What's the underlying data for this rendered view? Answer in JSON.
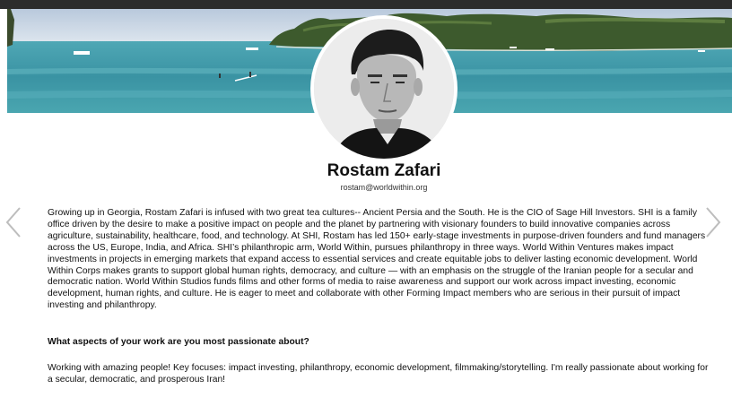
{
  "profile": {
    "name": "Rostam Zafari",
    "email": "rostam@worldwithin.org",
    "bio": "Growing up in Georgia, Rostam Zafari is infused with two great tea cultures-- Ancient Persia and the South. He is the CIO of Sage Hill Investors. SHI is a family office driven by the desire to make a positive impact on people and the planet by partnering with visionary founders to build innovative companies across agriculture, sustainability, healthcare, food, and technology. At SHI, Rostam has led 150+ early-stage investments in purpose-driven founders and fund managers across the US, Europe, India, and Africa. SHI’s philanthropic arm, World Within, pursues philanthropy in three ways. World Within Ventures makes impact investments in projects in emerging markets that expand access to essential services and create equitable jobs to deliver lasting economic development. World Within Corps makes grants to support global human rights, democracy, and culture — with an emphasis on the struggle of the Iranian people for a secular and democratic nation. World Within Studios funds films and other forms of media to raise awareness and support our work across impact investing, economic development, human rights, and culture. He is eager to meet and collaborate with other Forming Impact members who are serious in their pursuit of impact investing and philanthropy.",
    "question": "What aspects of your work are you most passionate about?",
    "answer": "Working with amazing people! Key focuses: impact investing, philanthropy, economic development, filmmaking/storytelling. I'm really passionate about working for a secular, democratic, and prosperous Iran!"
  },
  "icons": {
    "prev": "chevron-left-icon",
    "next": "chevron-right-icon"
  },
  "colors": {
    "topbar": "#2c2c2c",
    "sea": "#3f97a6",
    "sky": "#cfdcea",
    "island": "#3e5a2c",
    "arrow": "#bdbdbd"
  }
}
